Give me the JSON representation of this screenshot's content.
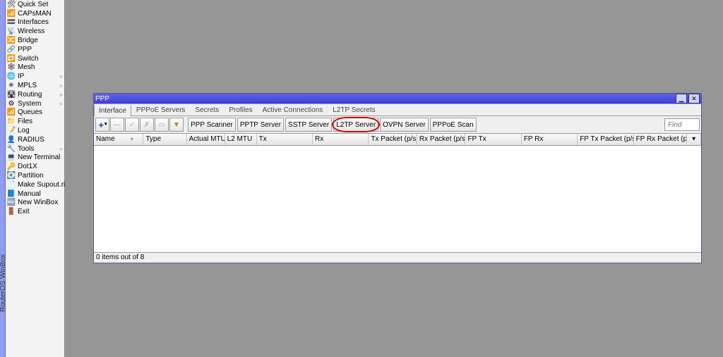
{
  "app_name": "RouterOS WinBox",
  "sidebar": [
    {
      "icon": "🛠",
      "label": "Quick Set"
    },
    {
      "icon": "📶",
      "label": "CAPsMAN"
    },
    {
      "icon": "🟰",
      "label": "Interfaces"
    },
    {
      "icon": "📡",
      "label": "Wireless"
    },
    {
      "icon": "🔀",
      "label": "Bridge"
    },
    {
      "icon": "🔗",
      "label": "PPP"
    },
    {
      "icon": "🔁",
      "label": "Switch"
    },
    {
      "icon": "🕸",
      "label": "Mesh"
    },
    {
      "icon": "🌐",
      "label": "IP",
      "sub": true
    },
    {
      "icon": "✳",
      "label": "MPLS",
      "sub": true
    },
    {
      "icon": "🛣",
      "label": "Routing",
      "sub": true
    },
    {
      "icon": "⚙",
      "label": "System",
      "sub": true
    },
    {
      "icon": "📶",
      "label": "Queues"
    },
    {
      "icon": "📁",
      "label": "Files"
    },
    {
      "icon": "📝",
      "label": "Log"
    },
    {
      "icon": "👤",
      "label": "RADIUS"
    },
    {
      "icon": "🔧",
      "label": "Tools",
      "sub": true
    },
    {
      "icon": "💻",
      "label": "New Terminal"
    },
    {
      "icon": "🔑",
      "label": "Dot1X"
    },
    {
      "icon": "💽",
      "label": "Partition"
    },
    {
      "icon": "📄",
      "label": "Make Supout.rif"
    },
    {
      "icon": "📘",
      "label": "Manual"
    },
    {
      "icon": "🆕",
      "label": "New WinBox"
    },
    {
      "icon": "🚪",
      "label": "Exit"
    }
  ],
  "window": {
    "title": "PPP",
    "tabs": [
      "Interface",
      "PPPoE Servers",
      "Secrets",
      "Profiles",
      "Active Connections",
      "L2TP Secrets"
    ],
    "active_tab": "Interface",
    "toolbar": {
      "buttons": [
        "PPP Scanner",
        "PPTP Server",
        "SSTP Server",
        "L2TP Server",
        "OVPN Server",
        "PPPoE Scan"
      ],
      "highlighted": "L2TP Server",
      "find_placeholder": "Find"
    },
    "columns": [
      "Name",
      "Type",
      "Actual MTU",
      "L2 MTU",
      "Tx",
      "Rx",
      "Tx Packet (p/s)",
      "Rx Packet (p/s)",
      "FP Tx",
      "FP Rx",
      "FP Tx Packet (p/s)",
      "FP Rx Packet (p/s)"
    ],
    "status": "0 items out of 8"
  }
}
